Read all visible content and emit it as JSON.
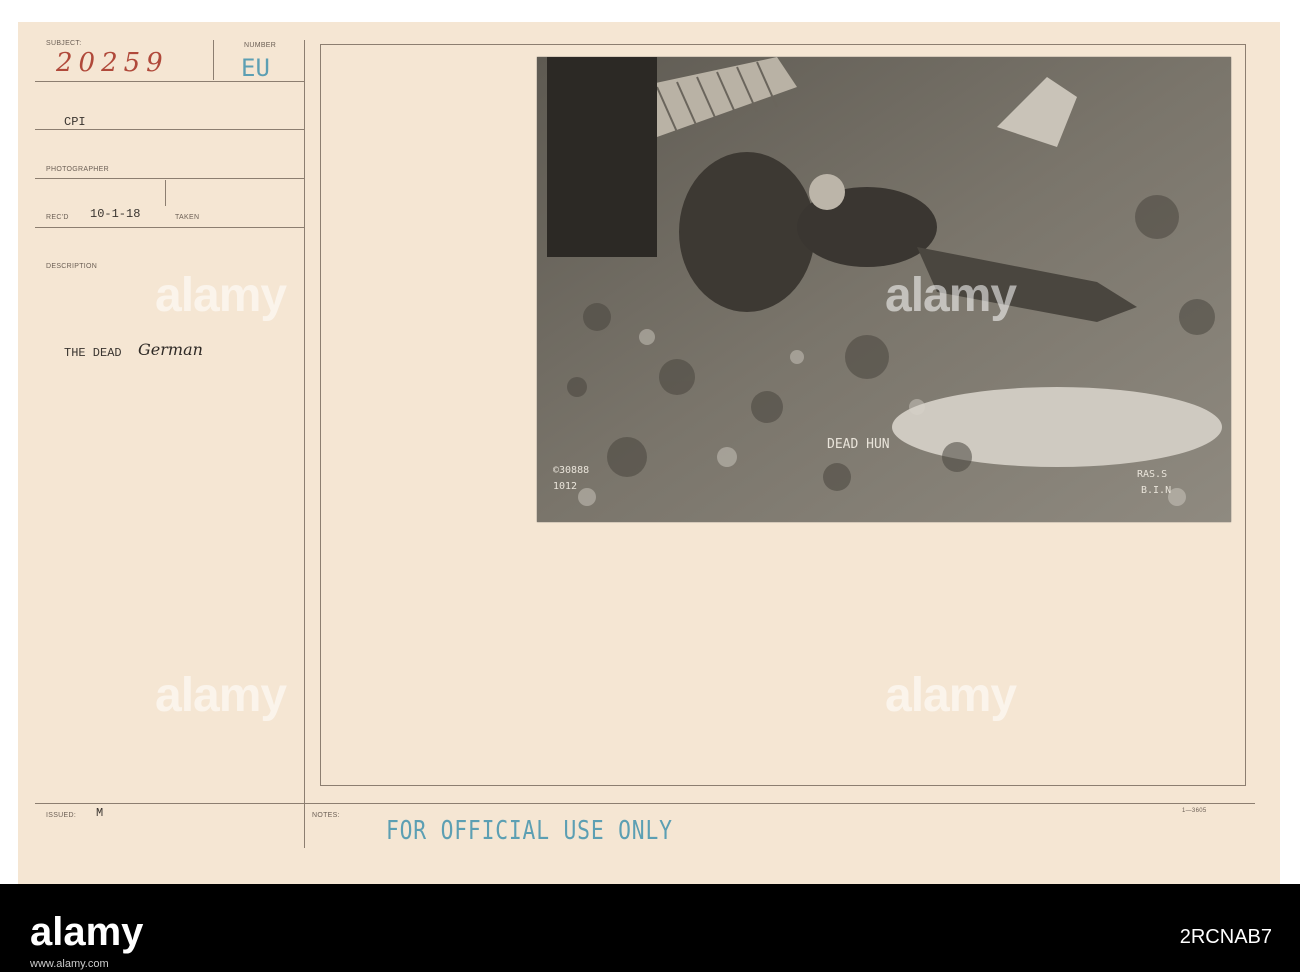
{
  "card": {
    "subject_label": "SUBJECT:",
    "subject_value": "20259",
    "number_label": "NUMBER",
    "number_value": "EU",
    "cpi": "CPI",
    "photographer_label": "PHOTOGRAPHER",
    "recd_label": "REC'D",
    "recd_value": "10-1-18",
    "taken_label": "TAKEN",
    "description_label": "DESCRIPTION",
    "description_typed": "THE DEAD",
    "description_hand": "German",
    "issued_label": "ISSUED:",
    "issued_value": "M",
    "notes_label": "NOTES:",
    "stamp": "FOR OFFICIAL USE ONLY",
    "form_number": "1—3605"
  },
  "photo": {
    "caption": "DEAD HUN",
    "left_marks": [
      "©30888",
      "1012"
    ],
    "right_marks": [
      "RAS.S",
      "B.I.N"
    ]
  },
  "watermark": {
    "text": "alamy",
    "color": "#ffffff"
  },
  "footer": {
    "logo": "alamy",
    "image_id": "2RCNAB7",
    "url": "www.alamy.com"
  }
}
